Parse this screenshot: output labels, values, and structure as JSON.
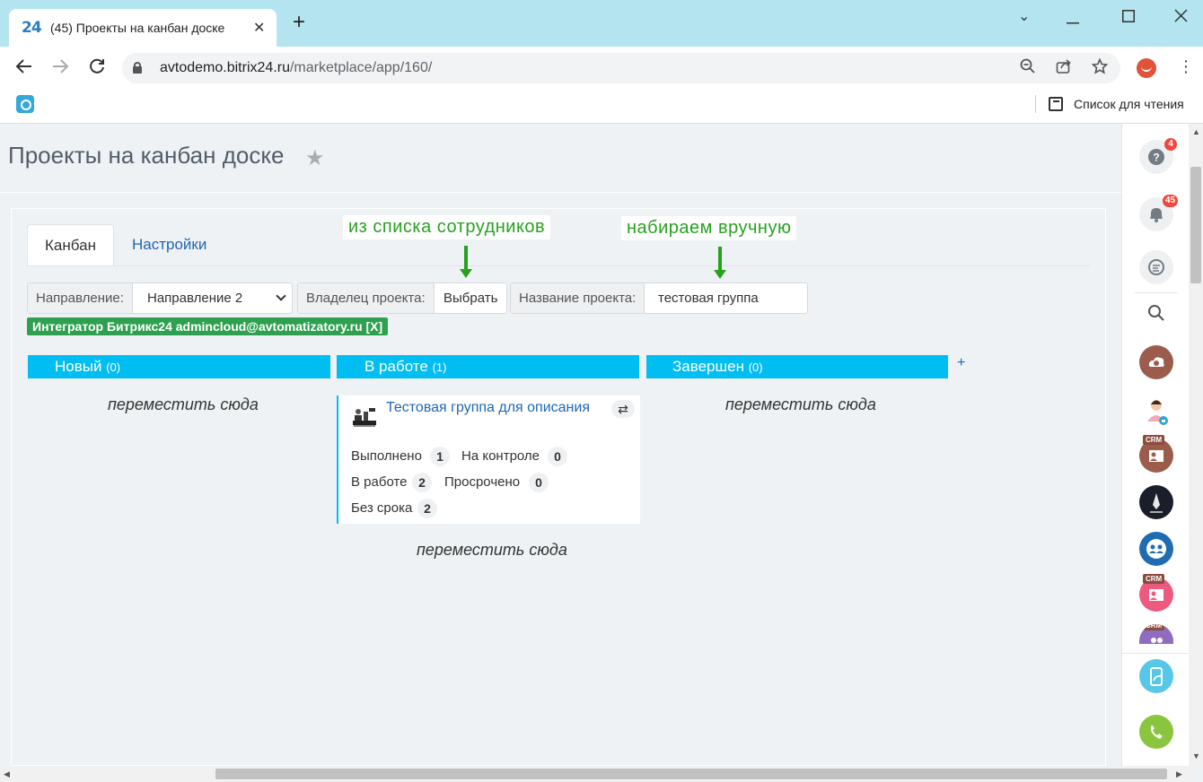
{
  "browser": {
    "tab_favicon": "24",
    "tab_title": "(45) Проекты на канбан доске",
    "url_host": "avtodemo.bitrix24.ru",
    "url_path": "/marketplace/app/160/",
    "reading_list_label": "Список для чтения"
  },
  "page": {
    "title": "Проекты на канбан доске"
  },
  "tabs": {
    "kanban": "Канбан",
    "settings": "Настройки"
  },
  "annotations": {
    "from_employees": "из списка сотрудников",
    "manual": "набираем вручную",
    "color": "#27a11f"
  },
  "filters": {
    "direction_label": "Направление:",
    "direction_value": "Направление 2",
    "owner_label": "Владелец проекта:",
    "owner_button": "Выбрать",
    "name_label": "Название проекта:",
    "name_value": "тестовая группа"
  },
  "selected_owner_tag": "Интегратор Битрикс24 admincloud@avtomatizatory.ru [X]",
  "columns": [
    {
      "title": "Новый",
      "count": "(0)"
    },
    {
      "title": "В работе",
      "count": "(1)"
    },
    {
      "title": "Завершен",
      "count": "(0)"
    }
  ],
  "add_column": "+",
  "drop_here": "переместить сюда",
  "card": {
    "title": "Тестовая группа для описания",
    "swap_icon": "⇄",
    "done_label": "Выполнено",
    "done_value": "1",
    "control_label": "На контроле",
    "control_value": "0",
    "inwork_label": "В работе",
    "inwork_value": "2",
    "overdue_label": "Просрочено",
    "overdue_value": "0",
    "nodeadline_label": "Без срока",
    "nodeadline_value": "2"
  },
  "sidebar": {
    "help_badge": "4",
    "notifications_badge": "45",
    "crm_label": "CRM",
    "accent_help": "#737b84",
    "accent_cloud": "#9b5c4c",
    "accent_chat": "#1f6db0",
    "accent_phone": "#8ac53f"
  },
  "colors": {
    "column_header": "#00bdf2",
    "tag": "#2ea04f",
    "link": "#2067b0"
  }
}
